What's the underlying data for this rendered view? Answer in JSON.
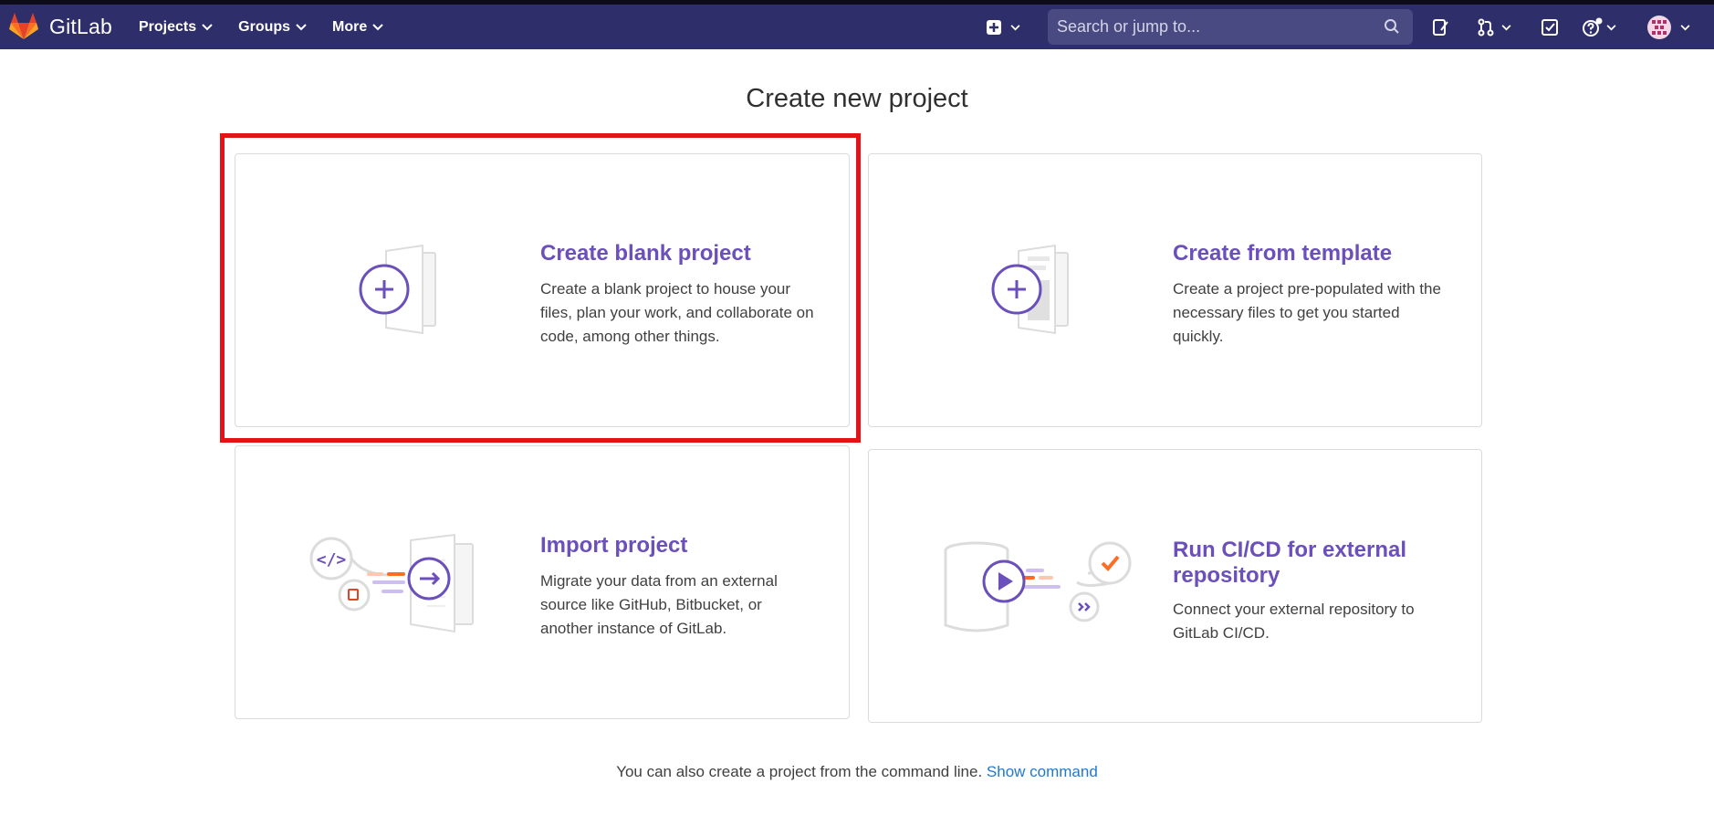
{
  "navbar": {
    "brand": "GitLab",
    "menu": [
      {
        "label": "Projects"
      },
      {
        "label": "Groups"
      },
      {
        "label": "More"
      }
    ],
    "search_placeholder": "Search or jump to...",
    "colors": {
      "background": "#2e2e6b",
      "search_bg": "#4a4a82",
      "logo_orange": "#e2432a"
    }
  },
  "page": {
    "title": "Create new project",
    "cards": [
      {
        "title": "Create blank project",
        "description": "Create a blank project to house your files, plan your work, and collaborate on code, among other things."
      },
      {
        "title": "Create from template",
        "description": "Create a project pre-populated with the necessary files to get you started quickly."
      },
      {
        "title": "Import project",
        "description": "Migrate your data from an external source like GitHub, Bitbucket, or another instance of GitLab."
      },
      {
        "title": "Run CI/CD for external repository",
        "description": "Connect your external repository to GitLab CI/CD."
      }
    ],
    "footer_text": "You can also create a project from the command line.",
    "footer_link": "Show command",
    "colors": {
      "accent": "#6b4fbb",
      "link": "#1f78d1",
      "highlight": "#e0141a"
    }
  }
}
